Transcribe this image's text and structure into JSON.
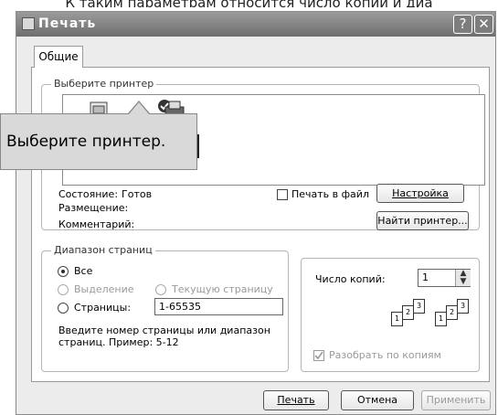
{
  "page_top_text": "К таким параметрам относится число копий и диа",
  "window": {
    "title": "Печать",
    "help_label": "?",
    "close_label": "✕"
  },
  "tabs": [
    {
      "label": "Общие"
    }
  ],
  "printer_group": {
    "legend": "Выберите принтер",
    "tooltip": "Выберите принтер.",
    "status_label": "Состояние:",
    "status_value": "Готов",
    "location_label": "Размещение:",
    "comment_label": "Комментарий:",
    "print_to_file_label": "Печать в файл",
    "print_to_file_checked": false,
    "settings_button": "Настройка",
    "find_printer_button": "Найти принтер..."
  },
  "range_group": {
    "legend": "Диапазон страниц",
    "all_label": "Все",
    "selection_label": "Выделение",
    "current_page_label": "Текущую страницу",
    "pages_label": "Страницы:",
    "pages_value": "1-65535",
    "hint": "Введите номер страницы или диапазон страниц.  Пример: 5-12",
    "selected": "all"
  },
  "copies": {
    "label": "Число копий:",
    "value": "1",
    "collate_label": "Разобрать по копиям",
    "collate_checked": true,
    "collate_pages": [
      "1",
      "2",
      "3"
    ]
  },
  "footer": {
    "print_button": "Печать",
    "cancel_button": "Отмена",
    "apply_button": "Применить"
  }
}
